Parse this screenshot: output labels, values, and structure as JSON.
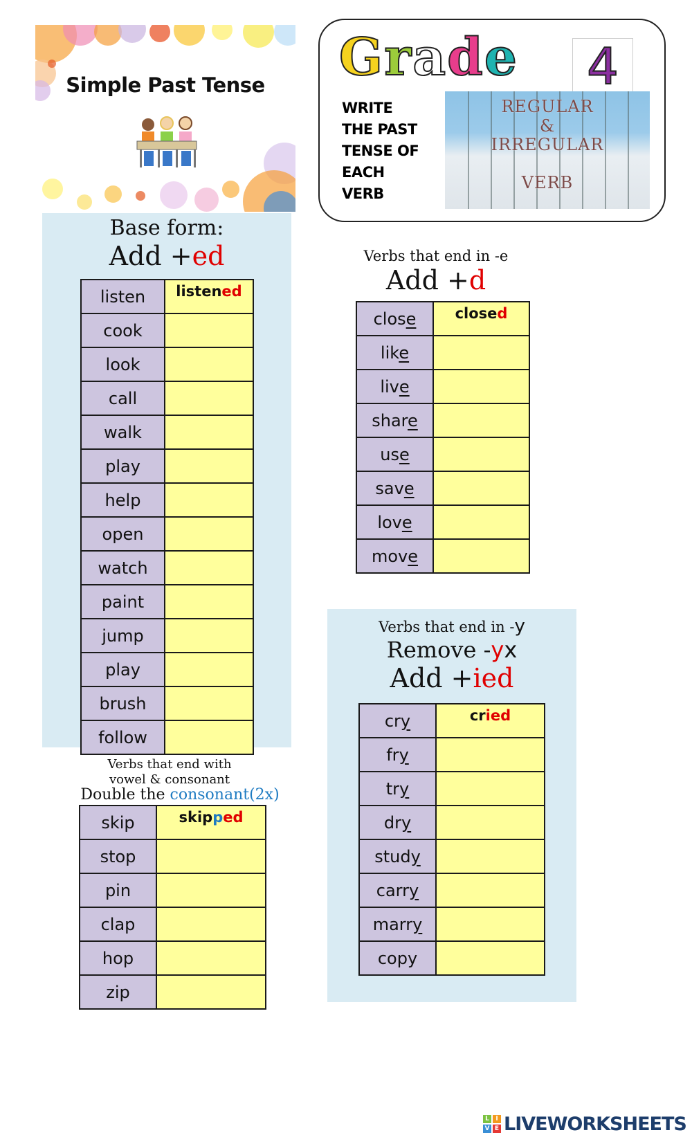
{
  "banner": {
    "title": "Simple Past Tense",
    "illustration": "children-at-desks-illustration"
  },
  "grade_card": {
    "grade_word": "Grade",
    "grade_number": "4",
    "instruction_lines": [
      "WRITE",
      "THE PAST",
      "TENSE OF",
      "EACH",
      "VERB"
    ],
    "wood_lines": [
      "REGULAR",
      "&",
      "IRREGULAR",
      "VERB"
    ]
  },
  "sections": [
    {
      "id": "base-form",
      "heading_line1": "Base form:",
      "heading_prefix": "Add +",
      "heading_suffix": "ed",
      "example": {
        "stem": "listen",
        "ending": "ed"
      },
      "verbs": [
        "listen",
        "cook",
        "look",
        "call",
        "walk",
        "play",
        "help",
        "open",
        "watch",
        "paint",
        "jump",
        "play",
        "brush",
        "follow"
      ]
    },
    {
      "id": "end-in-e",
      "subheading": "Verbs that end in -e",
      "heading_prefix": "Add +",
      "heading_suffix": "d",
      "example": {
        "stem": "close",
        "ending": "d"
      },
      "verbs": [
        {
          "stem": "clos",
          "last": "e"
        },
        {
          "stem": "lik",
          "last": "e"
        },
        {
          "stem": "liv",
          "last": "e"
        },
        {
          "stem": "shar",
          "last": "e"
        },
        {
          "stem": "us",
          "last": "e"
        },
        {
          "stem": "sav",
          "last": "e"
        },
        {
          "stem": "lov",
          "last": "e"
        },
        {
          "stem": "mov",
          "last": "e"
        }
      ]
    },
    {
      "id": "end-in-y",
      "subheading_prefix": "Verbs that end in -",
      "subheading_y": "y",
      "remove_prefix": "Remove -",
      "remove_y": "y",
      "remove_x": "x",
      "heading_prefix": "Add +",
      "heading_suffix": "ied",
      "example": {
        "stem": "cr",
        "ending": "ied"
      },
      "verbs": [
        {
          "stem": "cr",
          "last": "y"
        },
        {
          "stem": "fr",
          "last": "y"
        },
        {
          "stem": "tr",
          "last": "y"
        },
        {
          "stem": "dr",
          "last": "y"
        },
        {
          "stem": "stud",
          "last": "y"
        },
        {
          "stem": "carr",
          "last": "y"
        },
        {
          "stem": "marr",
          "last": "y"
        },
        {
          "stem": "copy",
          "last": ""
        }
      ]
    },
    {
      "id": "double-consonant",
      "subheading_line1": "Verbs that end with",
      "subheading_line2": "vowel & consonant",
      "heading_prefix": "Double the ",
      "heading_suffix": "consonant(2x)",
      "example": {
        "stem": "skip",
        "double": "p",
        "ending": "ed"
      },
      "verbs": [
        "skip",
        "stop",
        "pin",
        "clap",
        "hop",
        "zip"
      ]
    }
  ],
  "colors": {
    "base_cell": "#cdc5df",
    "answer_cell": "#ffff9c",
    "panel": "#d9ebf3",
    "ending_red": "#e00000",
    "consonant_blue": "#1e7bc2"
  },
  "footer": {
    "logo_tiles": [
      "L",
      "I",
      "V",
      "E"
    ],
    "logo_text": "LIVEWORKSHEETS"
  }
}
